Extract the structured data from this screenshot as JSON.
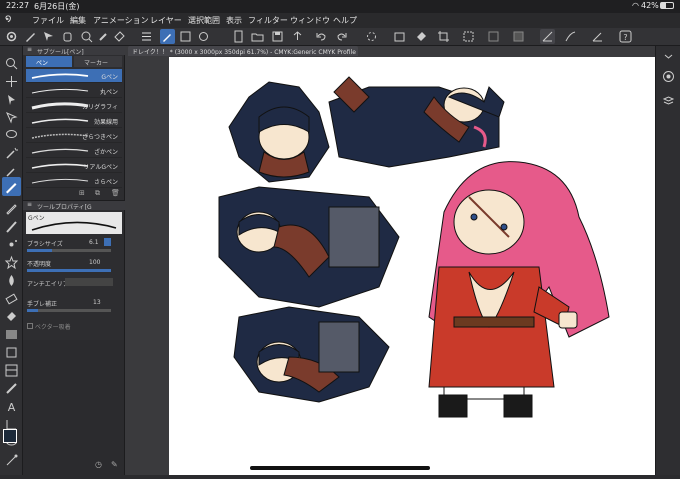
{
  "status": {
    "time": "22:27",
    "date": "6月26日(金)",
    "battery": "42%"
  },
  "menu": [
    "ファイル",
    "編集",
    "アニメーション",
    "レイヤー",
    "選択範囲",
    "表示",
    "フィルター",
    "ウィンドウ",
    "ヘルプ"
  ],
  "subtool": {
    "title": "サブツール[ペン]",
    "tabs": [
      "ペン",
      "マーカー"
    ],
    "brushes": [
      "Gペン",
      "丸ペン",
      "カリグラフィ",
      "効果線用",
      "ざらつきペン",
      "ざかペン",
      "リアルGペン",
      "さらペン"
    ]
  },
  "document": {
    "tab_title": "ドレイク！！ * (3000 x 3000px 350dpi 61.7%) - CMYK:Generic CMYK Profile"
  },
  "tool_property": {
    "title": "ツールプロパティ[G",
    "preview_label": "Gペン",
    "brush_size_label": "ブラシサイズ",
    "brush_size_value": "6.1",
    "opacity_label": "不透明度",
    "opacity_value": "100",
    "antialias_label": "アンチエイリア",
    "stabilization_label": "手ブレ補正",
    "stabilization_value": "13",
    "vector_label": "ベクター吸着"
  },
  "colors": {
    "accent": "#3d6fb5",
    "main_color": "#1d2a3a",
    "sub_color": "#f4ef5b",
    "paper": "#ffffff",
    "hair_dark": "#1f2a44",
    "hair_pink": "#e65a8a",
    "coat_red": "#c93a2a"
  }
}
